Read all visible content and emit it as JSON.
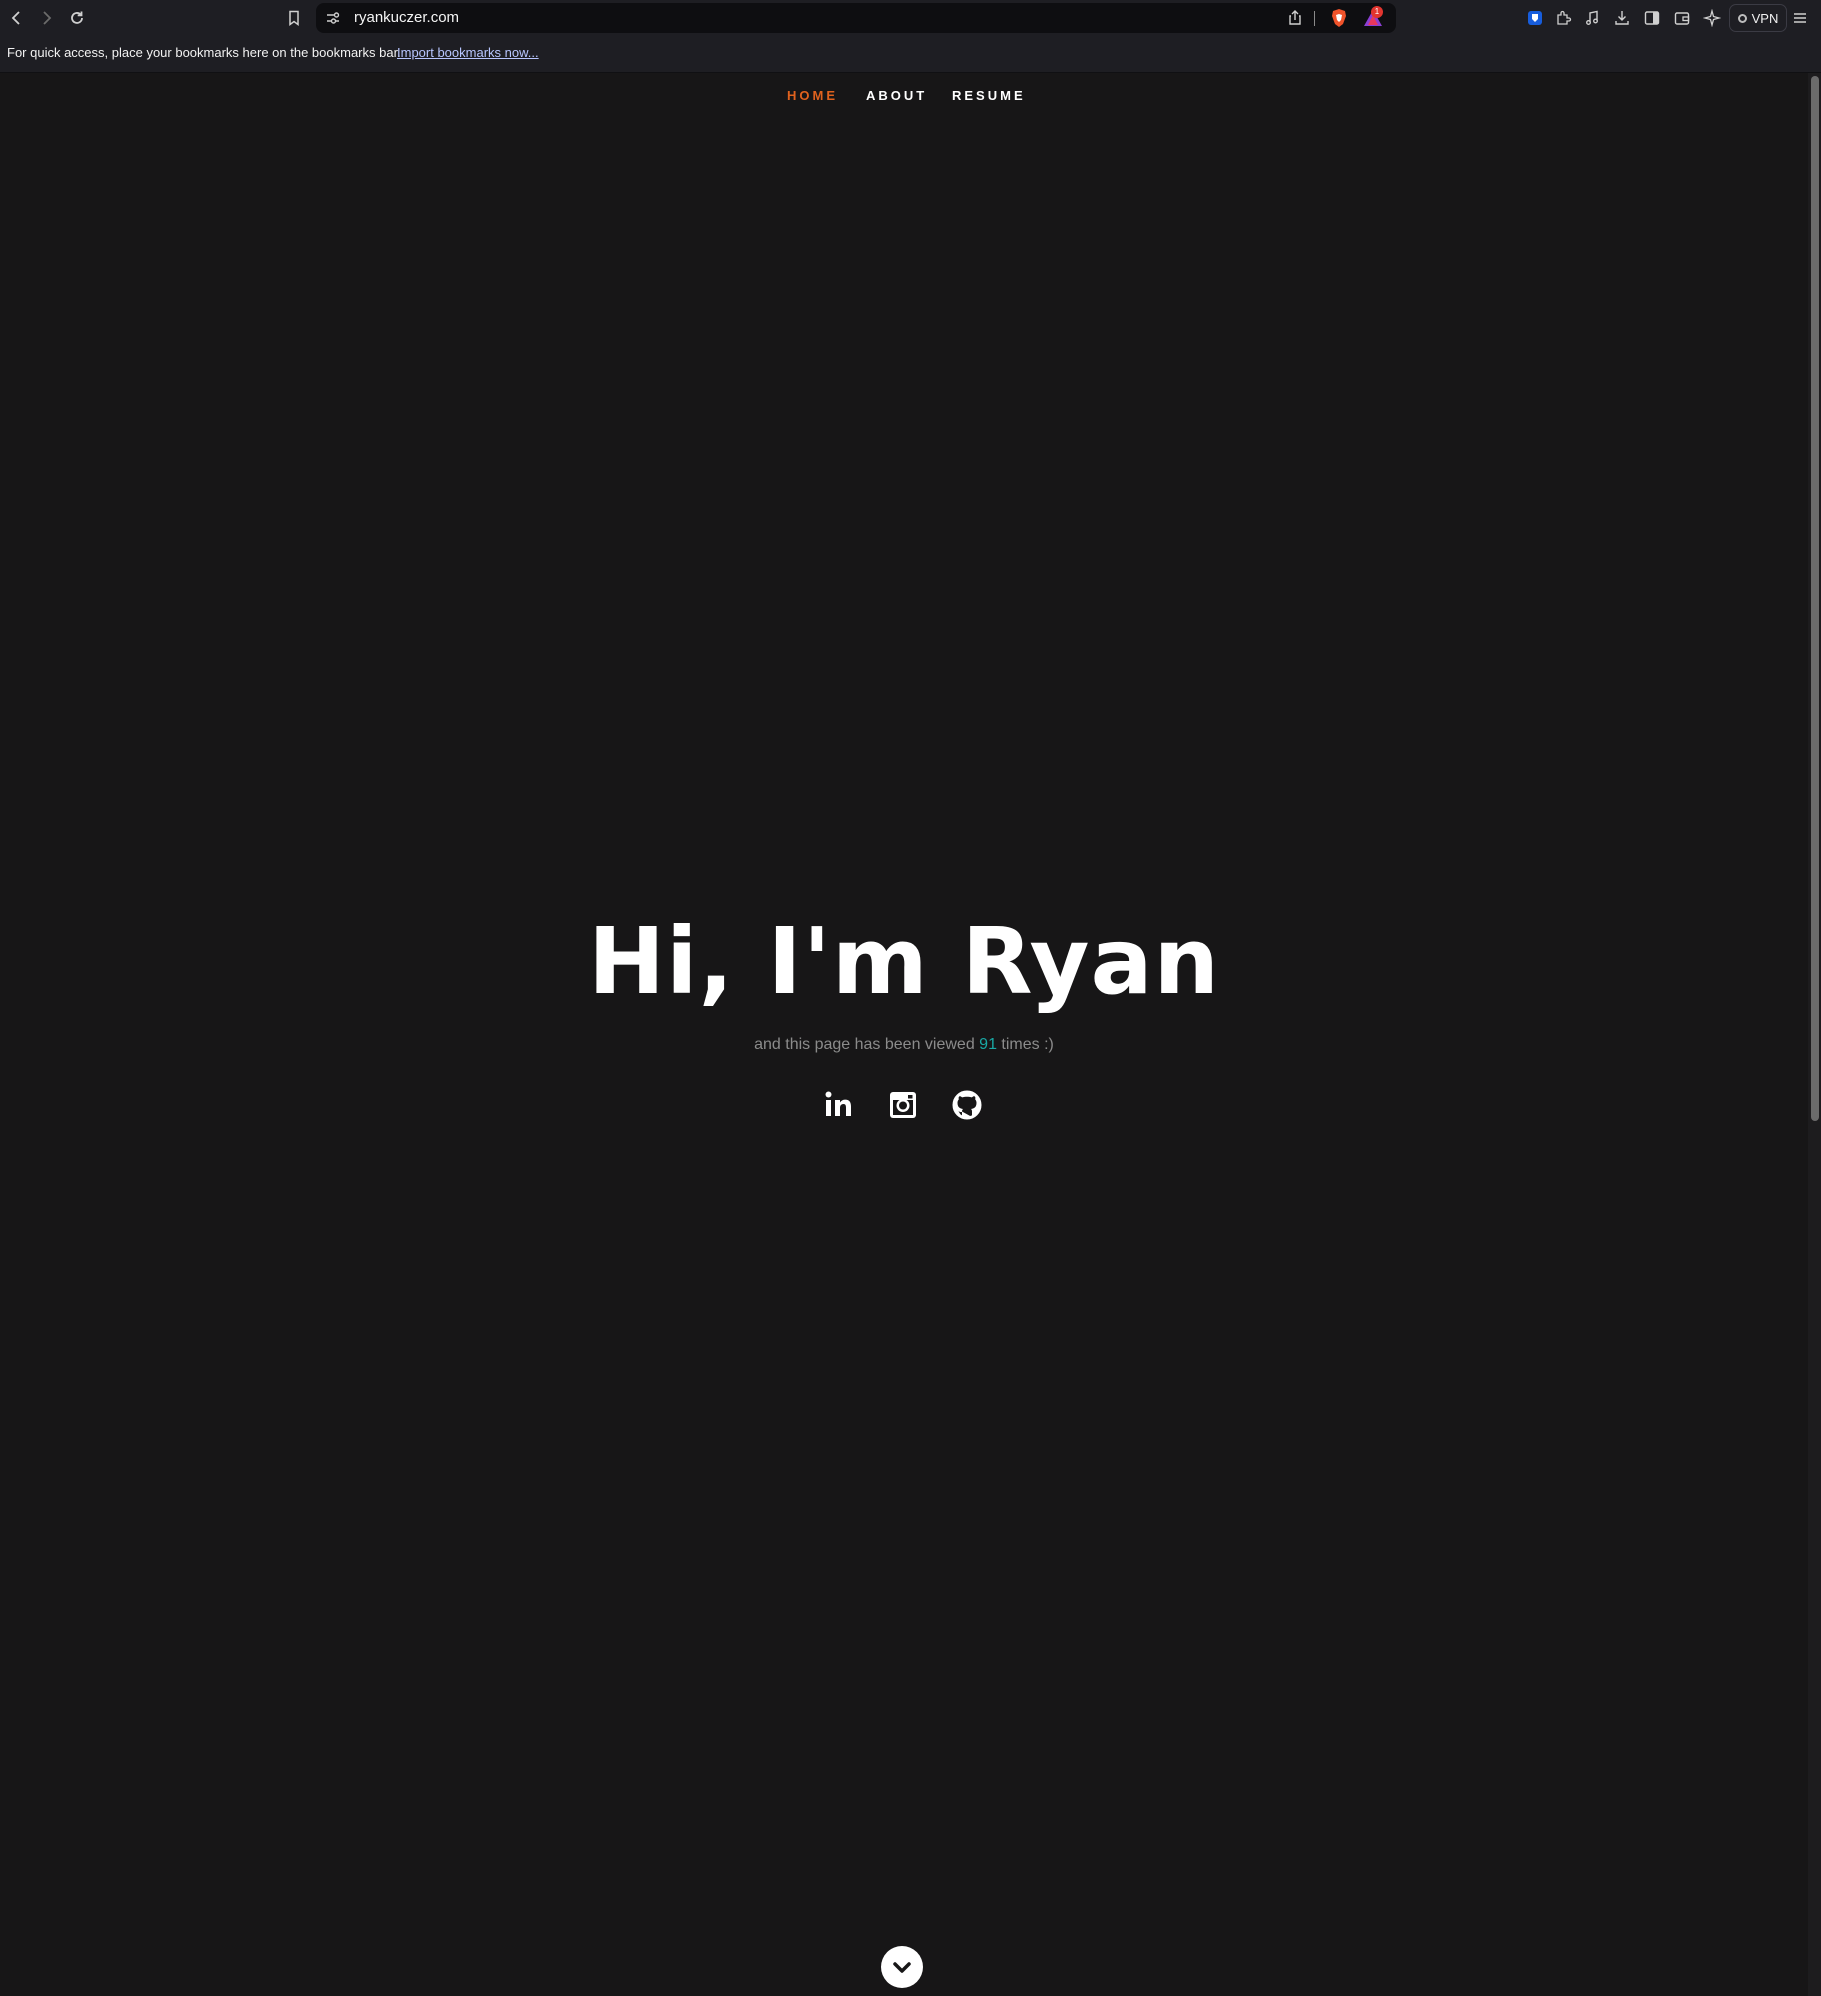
{
  "browser": {
    "url": "ryankuczer.com",
    "rewards_badge": "1",
    "vpn_label": "VPN",
    "bookmarks_bar": {
      "message": "For quick access, place your bookmarks here on the bookmarks bar.",
      "import_link": "Import bookmarks now..."
    }
  },
  "nav": {
    "items": [
      {
        "label": "HOME",
        "active": true
      },
      {
        "label": "ABOUT",
        "active": false
      },
      {
        "label": "RESUME",
        "active": false
      }
    ]
  },
  "hero": {
    "title": "Hi, I'm Ryan",
    "subtitle_before": "and this page has been viewed",
    "view_count": "91",
    "subtitle_after": "times :)"
  },
  "socials": [
    "linkedin-icon",
    "instagram-icon",
    "github-icon"
  ],
  "colors": {
    "background": "#171617",
    "nav_active": "#e0621e",
    "view_count": "#19a8a4",
    "subtitle": "#8b8b8b"
  }
}
